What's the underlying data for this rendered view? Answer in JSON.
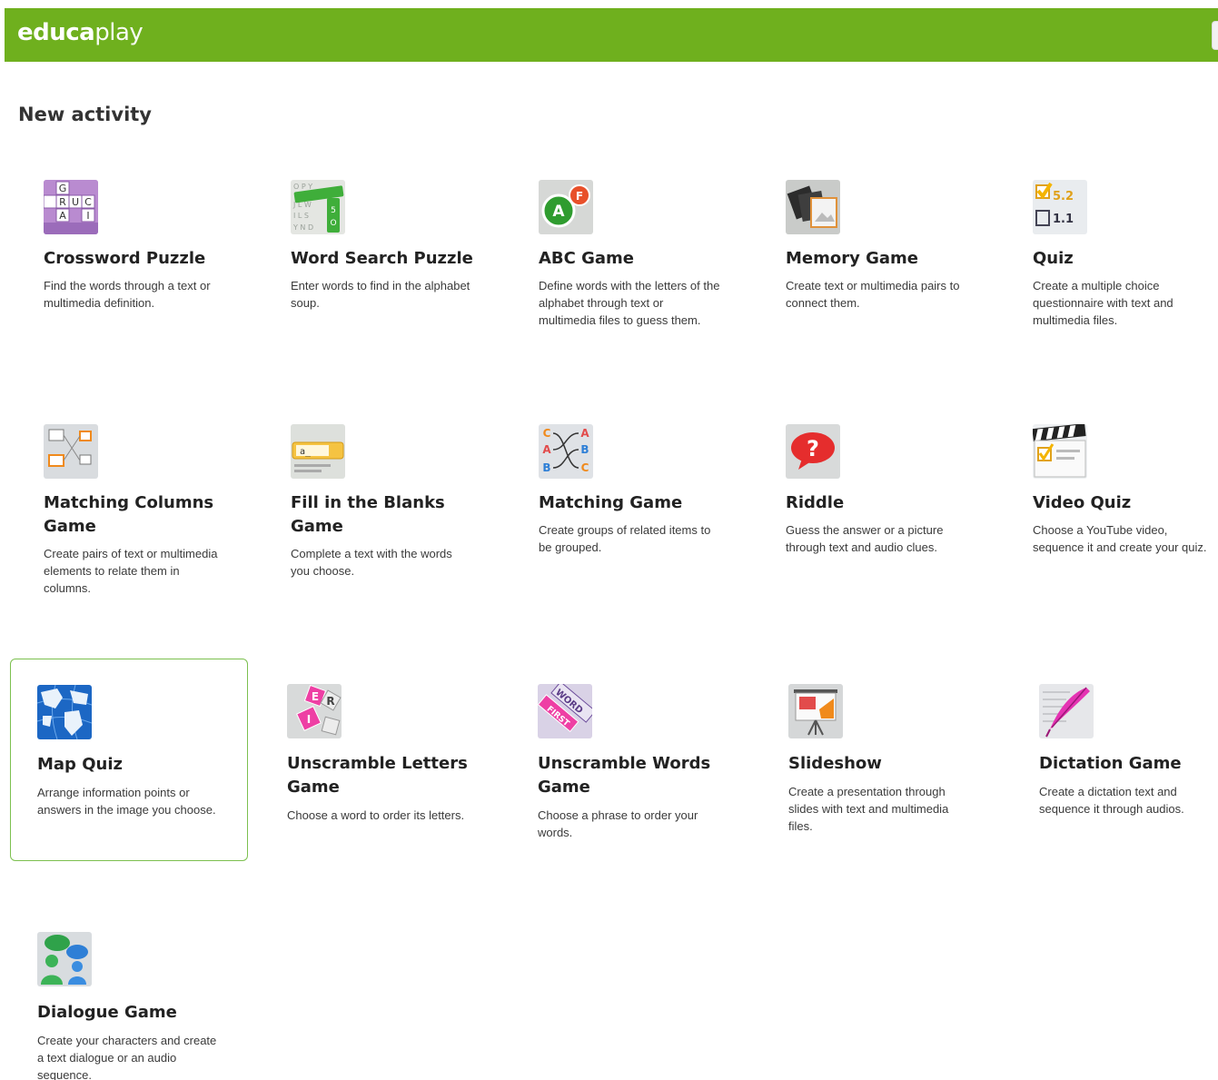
{
  "header": {
    "logo_part1": "educa",
    "logo_part2": "play"
  },
  "page": {
    "title": "New activity"
  },
  "activities": [
    {
      "title": "Crossword Puzzle",
      "description": "Find the words through a text or multimedia definition.",
      "icon": "crossword-icon"
    },
    {
      "title": "Word Search Puzzle",
      "description": "Enter words to find in the alphabet soup.",
      "icon": "word-search-icon"
    },
    {
      "title": "ABC Game",
      "description": "Define words with the letters of the alphabet through text or multimedia files to guess them.",
      "icon": "abc-icon"
    },
    {
      "title": "Memory Game",
      "description": "Create text or multimedia pairs to connect them.",
      "icon": "memory-icon"
    },
    {
      "title": "Quiz",
      "description": "Create a multiple choice questionnaire with text and multimedia files.",
      "icon": "quiz-icon"
    },
    {
      "title": "Matching Columns Game",
      "description": "Create pairs of text or multimedia elements to relate them in columns.",
      "icon": "matching-columns-icon"
    },
    {
      "title": "Fill in the Blanks Game",
      "description": "Complete a text with the words you choose.",
      "icon": "fill-blanks-icon"
    },
    {
      "title": "Matching Game",
      "description": "Create groups of related items to be grouped.",
      "icon": "matching-icon"
    },
    {
      "title": "Riddle",
      "description": "Guess the answer or a picture through text and audio clues.",
      "icon": "riddle-icon"
    },
    {
      "title": "Video Quiz",
      "description": "Choose a YouTube video, sequence it and create your quiz.",
      "icon": "video-quiz-icon"
    },
    {
      "title": "Map Quiz",
      "description": "Arrange information points or answers in the image you choose.",
      "icon": "map-icon"
    },
    {
      "title": "Unscramble Letters Game",
      "description": "Choose a word to order its letters.",
      "icon": "unscramble-letters-icon"
    },
    {
      "title": "Unscramble Words Game",
      "description": "Choose a phrase to order your words.",
      "icon": "unscramble-words-icon"
    },
    {
      "title": "Slideshow",
      "description": "Create a presentation through slides with text and multimedia files.",
      "icon": "slideshow-icon"
    },
    {
      "title": "Dictation Game",
      "description": "Create a dictation text and sequence it through audios.",
      "icon": "dictation-icon"
    },
    {
      "title": "Dialogue Game",
      "description": "Create your characters and create a text dialogue or an audio sequence.",
      "icon": "dialogue-icon"
    }
  ],
  "thumb_text": {
    "crossword": [
      "G",
      "R",
      "U",
      "C",
      "A",
      "I"
    ],
    "abc": [
      "A",
      "F"
    ],
    "quiz": [
      "5.2",
      "1.1"
    ],
    "matching": [
      "C",
      "A",
      "A",
      "B",
      "B",
      "C"
    ],
    "riddle": "?",
    "unscramble_letters": [
      "E",
      "R",
      "I"
    ],
    "unscramble_words": [
      "WORD",
      "FIRST"
    ],
    "fill_blanks": "a_"
  },
  "colors": {
    "brand_green": "#6fb01e",
    "selected_border": "#7cc04f"
  }
}
